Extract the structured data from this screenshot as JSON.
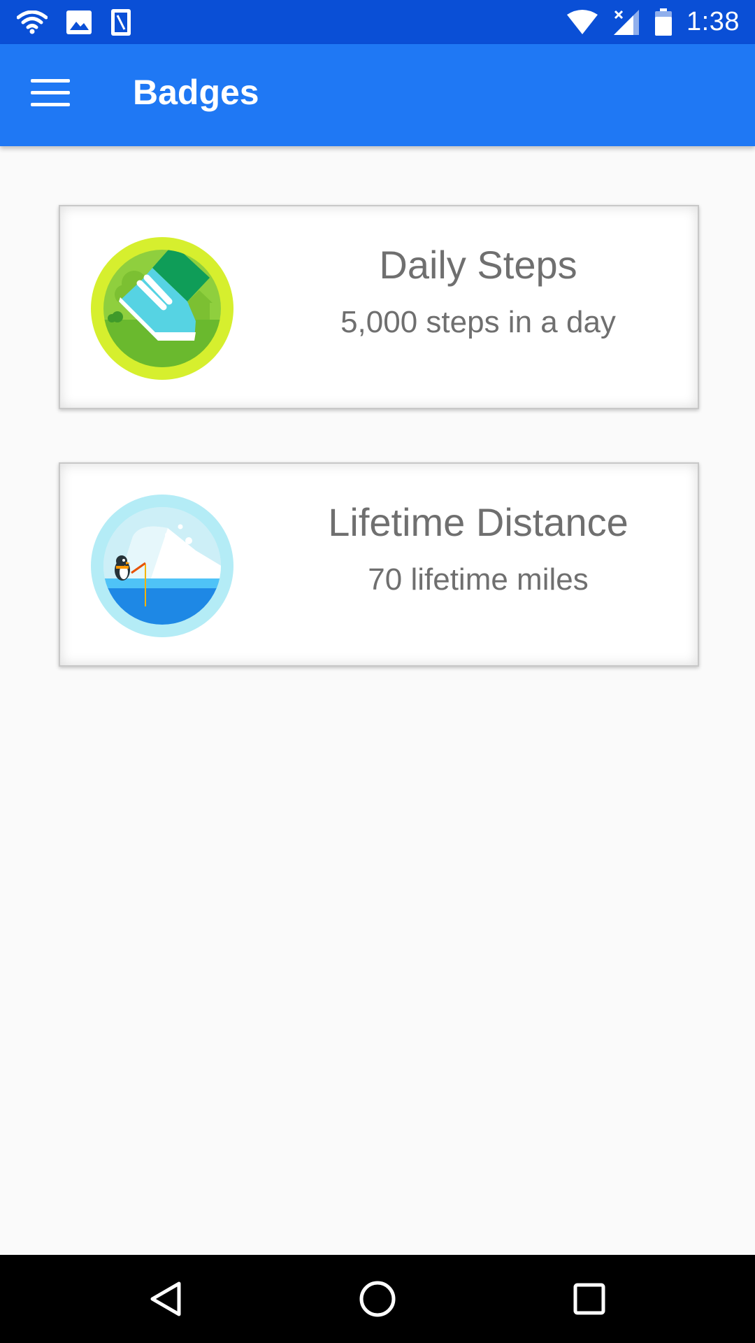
{
  "status_bar": {
    "time": "1:38",
    "left_icons": [
      "wifi-icon",
      "image-icon",
      "sim-card-icon"
    ],
    "right_icons": [
      "wifi-signal-icon",
      "cell-signal-icon",
      "battery-icon"
    ]
  },
  "app_bar": {
    "title": "Badges",
    "menu_icon": "hamburger-menu-icon",
    "color": "#1f78f4"
  },
  "badges": [
    {
      "title": "Daily Steps",
      "subtitle": "5,000 steps in a day",
      "icon": "shoe-badge-icon"
    },
    {
      "title": "Lifetime Distance",
      "subtitle": "70 lifetime miles",
      "icon": "penguin-fishing-badge-icon"
    }
  ],
  "nav_bar": {
    "buttons": [
      "back-icon",
      "home-icon",
      "recents-icon"
    ]
  }
}
